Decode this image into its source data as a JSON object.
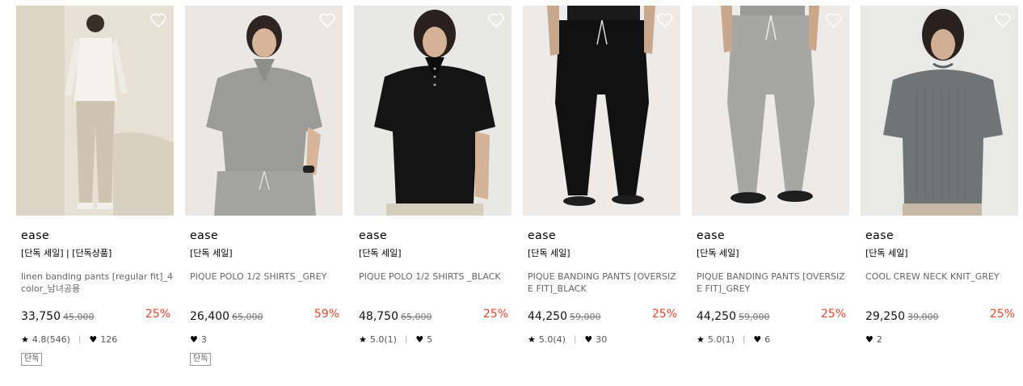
{
  "colors": {
    "discount": "#e8462b",
    "wish_icon": "#ffffff"
  },
  "products": [
    {
      "brand": "ease",
      "tags": "[단독 세일] | [단독상품]",
      "name": "linen banding pants [regular fit]_4color_남녀공용",
      "price": "33,750",
      "original_price": "45,000",
      "discount": "25%",
      "rating": "4.8(546)",
      "likes": "126",
      "badge": "단독",
      "image": "model-white-shirt-beige-pants",
      "wish_icon": "heart-outline-icon"
    },
    {
      "brand": "ease",
      "tags": "[단독 세일]",
      "name": "PIQUE POLO 1/2 SHIRTS _GREY",
      "price": "26,400",
      "original_price": "65,000",
      "discount": "59%",
      "likes": "3",
      "badge": "단독",
      "image": "model-grey-polo",
      "wish_icon": "heart-outline-icon"
    },
    {
      "brand": "ease",
      "tags": "[단독 세일]",
      "name": "PIQUE POLO 1/2 SHIRTS _BLACK",
      "price": "48,750",
      "original_price": "65,000",
      "discount": "25%",
      "rating": "5.0(1)",
      "likes": "5",
      "image": "model-black-polo",
      "wish_icon": "heart-outline-icon"
    },
    {
      "brand": "ease",
      "tags": "[단독 세일]",
      "name": "PIQUE BANDING PANTS [OVERSIZE FIT]_BLACK",
      "price": "44,250",
      "original_price": "59,000",
      "discount": "25%",
      "rating": "5.0(4)",
      "likes": "30",
      "image": "model-black-pants",
      "wish_icon": "heart-outline-icon"
    },
    {
      "brand": "ease",
      "tags": "[단독 세일]",
      "name": "PIQUE BANDING PANTS [OVERSIZE FIT]_GREY",
      "price": "44,250",
      "original_price": "59,000",
      "discount": "25%",
      "rating": "5.0(1)",
      "likes": "6",
      "image": "model-grey-pants",
      "wish_icon": "heart-outline-icon"
    },
    {
      "brand": "ease",
      "tags": "[단독 세일]",
      "name": "COOL CREW NECK KNIT_GREY",
      "price": "29,250",
      "original_price": "39,000",
      "discount": "25%",
      "likes": "2",
      "image": "model-grey-knit",
      "wish_icon": "heart-outline-icon"
    }
  ]
}
